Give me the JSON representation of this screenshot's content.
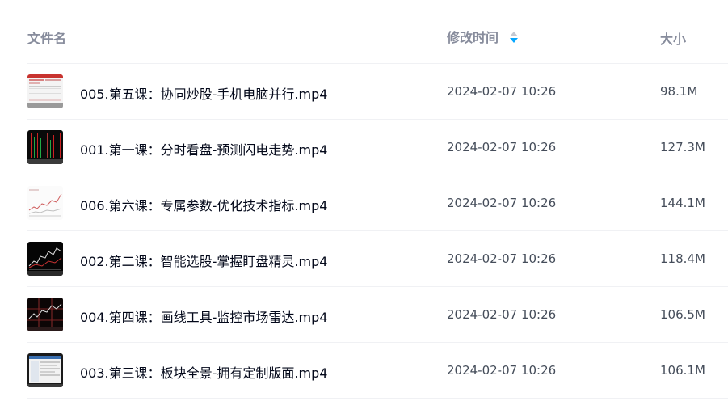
{
  "header": {
    "name": "文件名",
    "time": "修改时间",
    "size": "大小"
  },
  "colors": {
    "sort_active": "#06a7ff",
    "sort_inactive": "#c4c8d1",
    "header_text": "#878c9c",
    "name_text": "#03081a",
    "meta_text": "#454d5a"
  },
  "files": [
    {
      "name": "005.第五课：协同炒股-手机电脑并行.mp4",
      "time": "2024-02-07 10:26",
      "size": "98.1M",
      "thumb": "video-thumbnail-light-red"
    },
    {
      "name": "001.第一课：分时看盘-预测闪电走势.mp4",
      "time": "2024-02-07 10:26",
      "size": "127.3M",
      "thumb": "video-thumbnail-dark-bars"
    },
    {
      "name": "006.第六课：专属参数-优化技术指标.mp4",
      "time": "2024-02-07 10:26",
      "size": "144.1M",
      "thumb": "video-thumbnail-light-chart"
    },
    {
      "name": "002.第二课：智能选股-掌握盯盘精灵.mp4",
      "time": "2024-02-07 10:26",
      "size": "118.4M",
      "thumb": "video-thumbnail-dark-chart"
    },
    {
      "name": "004.第四课：画线工具-监控市场雷达.mp4",
      "time": "2024-02-07 10:26",
      "size": "106.5M",
      "thumb": "video-thumbnail-dark-lines"
    },
    {
      "name": "003.第三课：板块全景-拥有定制版面.mp4",
      "time": "2024-02-07 10:26",
      "size": "106.1M",
      "thumb": "video-thumbnail-light-window"
    }
  ]
}
